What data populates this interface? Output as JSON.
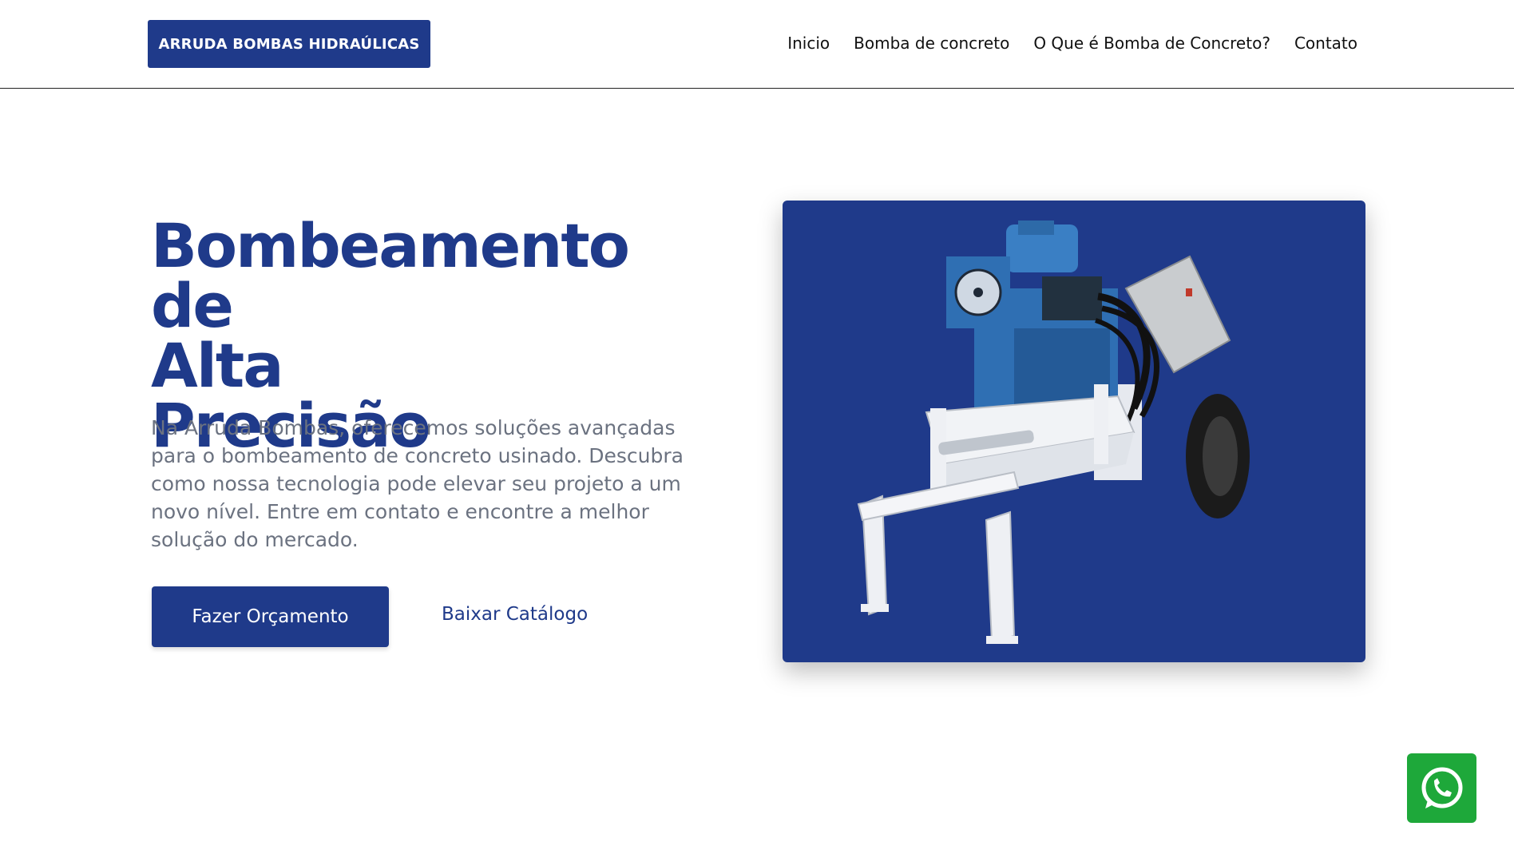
{
  "header": {
    "logo_text": "ARRUDA BOMBAS HIDRAÚLICAS",
    "nav": [
      "Inicio",
      "Bomba de concreto",
      "O Que é Bomba de Concreto?",
      "Contato"
    ]
  },
  "hero": {
    "title_lines": [
      "Bombeamento de",
      "Alta",
      "Precisão"
    ],
    "description": "Na Arruda Bombas, oferecemos soluções avançadas para o bombeamento de concreto usinado. Descubra como nossa tecnologia pode elevar seu projeto a um novo nível. Entre em contato e encontre a melhor solução do mercado.",
    "primary_button": "Fazer Orçamento",
    "secondary_link": "Baixar Catálogo"
  },
  "colors": {
    "brand": "#1f3a8a",
    "text_muted": "#6b7280",
    "whatsapp": "#1ea83a"
  },
  "icons": {
    "whatsapp": "whatsapp-icon",
    "product_image": "concrete-pump-machine"
  }
}
